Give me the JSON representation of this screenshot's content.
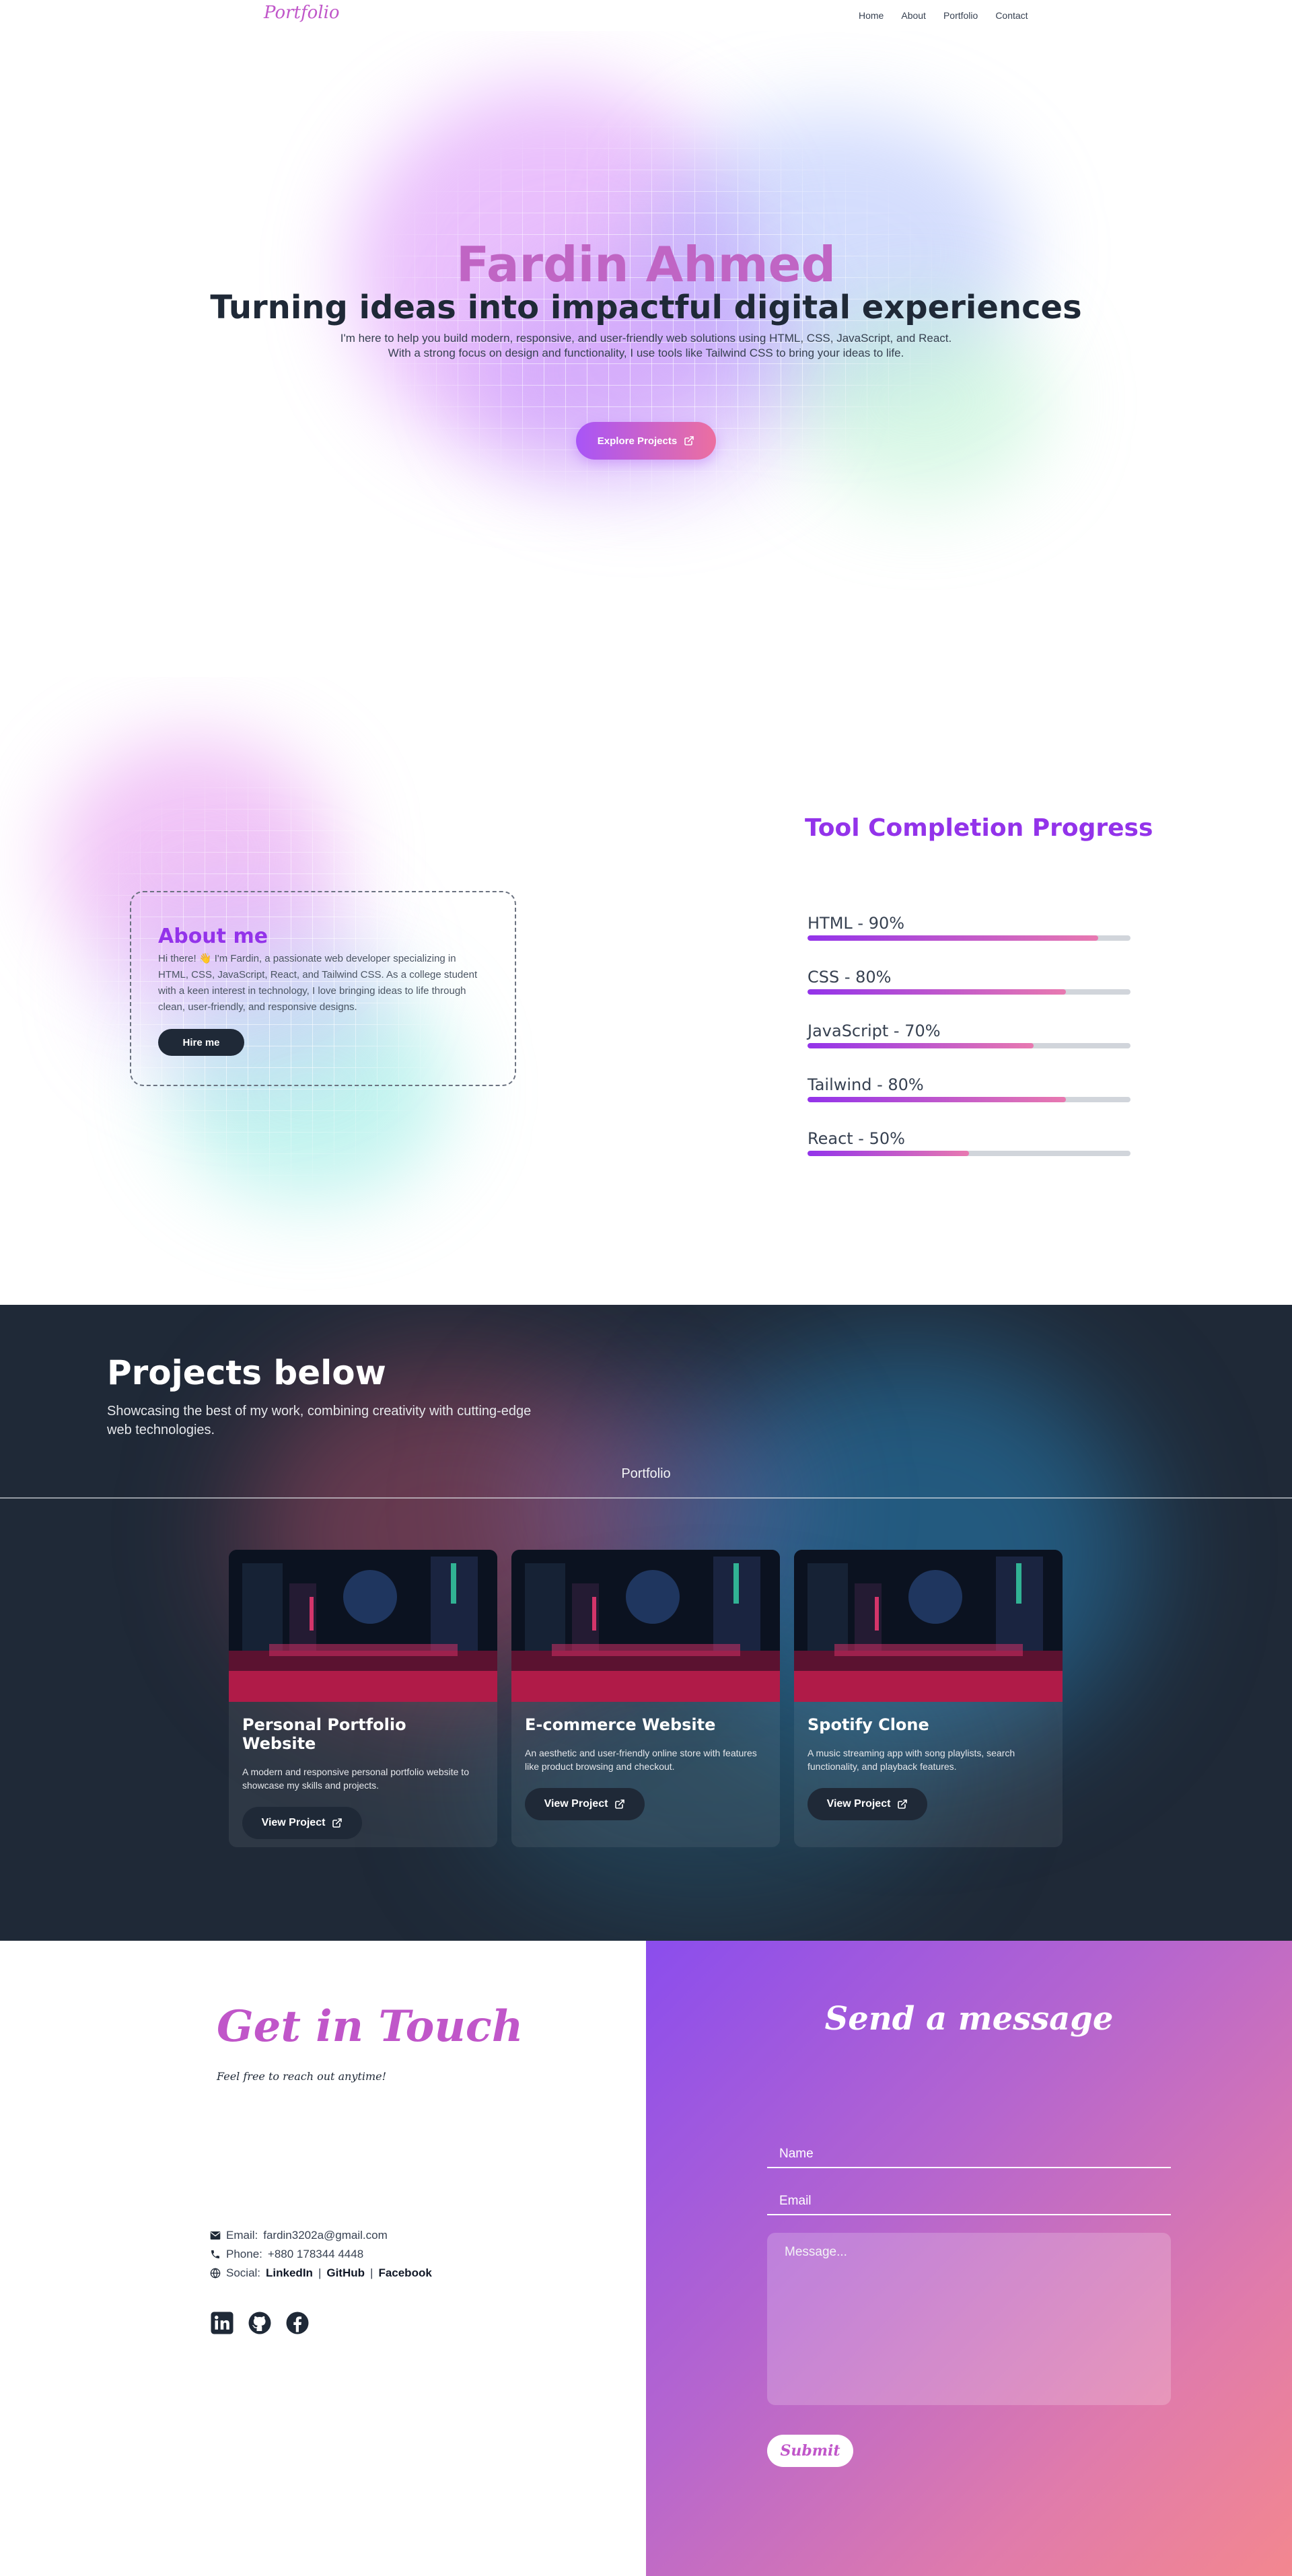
{
  "nav": {
    "logo": "Portfolio",
    "links": [
      "Home",
      "About",
      "Portfolio",
      "Contact"
    ]
  },
  "hero": {
    "name": "Fardin Ahmed",
    "title": "Turning ideas into impactful digital experiences",
    "subtitle_line1": "I'm here to help you build modern, responsive, and user-friendly web solutions using HTML, CSS, JavaScript, and React.",
    "subtitle_line2": "With a strong focus on design and functionality, I use tools like Tailwind CSS to bring your ideas to life.",
    "cta_label": "Explore Projects",
    "cta_icon": "external-link-icon"
  },
  "about": {
    "title": "About me",
    "text": "Hi there! 👋 I'm Fardin, a passionate web developer specializing in HTML, CSS, JavaScript, React, and Tailwind CSS. As a college student with a keen interest in technology, I love bringing ideas to life through clean, user-friendly, and responsive designs.",
    "button_label": "Hire me"
  },
  "progress": {
    "title": "Tool Completion Progress",
    "items": [
      {
        "label": "HTML - 90%",
        "value": 90
      },
      {
        "label": "CSS - 80%",
        "value": 80
      },
      {
        "label": "JavaScript - 70%",
        "value": 70
      },
      {
        "label": "Tailwind - 80%",
        "value": 80
      },
      {
        "label": "React - 50%",
        "value": 50
      }
    ]
  },
  "projects": {
    "title": "Projects below",
    "subtitle": "Showcasing the best of my work, combining creativity with cutting-edge web technologies.",
    "section_label": "Portfolio",
    "cards": [
      {
        "title": "Personal Portfolio Website",
        "desc": "A modern and responsive personal portfolio website to showcase my skills and projects.",
        "button": "View Project"
      },
      {
        "title": "E-commerce Website",
        "desc": "An aesthetic and user-friendly online store with features like product browsing and checkout.",
        "button": "View Project"
      },
      {
        "title": "Spotify Clone",
        "desc": "A music streaming app with song playlists, search functionality, and playback features.",
        "button": "View Project"
      }
    ]
  },
  "contact": {
    "title": "Get in Touch",
    "subtitle": "Feel free to reach out anytime!",
    "email_label": "Email:",
    "email": "fardin3202a@gmail.com",
    "phone_label": "Phone:",
    "phone": "+880 178344 4448",
    "social_label": "Social:",
    "social_links": [
      "LinkedIn",
      "GitHub",
      "Facebook"
    ],
    "social_separator": "|",
    "social_icons": [
      "linkedin-icon",
      "github-icon",
      "facebook-icon"
    ]
  },
  "form": {
    "title": "Send a message",
    "name_placeholder": "Name",
    "email_placeholder": "Email",
    "message_placeholder": "Message...",
    "submit_label": "Submit"
  },
  "colors": {
    "accent_purple": "#9333ea",
    "accent_pink": "#c056c9",
    "dark": "#1f2937"
  }
}
